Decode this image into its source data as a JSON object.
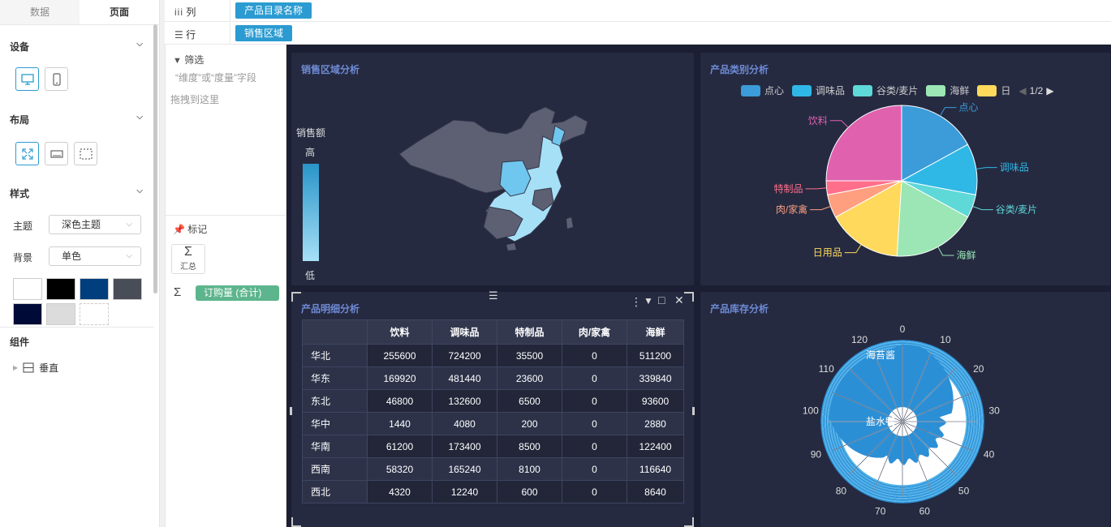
{
  "left_panel": {
    "tabs": [
      {
        "label": "数据",
        "active": false
      },
      {
        "label": "页面",
        "active": true
      }
    ],
    "device": {
      "title": "设备"
    },
    "layout": {
      "title": "布局"
    },
    "style": {
      "title": "样式",
      "theme_label": "主题",
      "theme_value": "深色主题",
      "background_label": "背景",
      "background_value": "单色",
      "swatches": [
        "#ffffff",
        "#000000",
        "#003e7e",
        "#494d58",
        "#000a36",
        "#dcdcdc",
        "#ffffff"
      ]
    },
    "components": {
      "title": "组件",
      "items": [
        {
          "label": "垂直"
        }
      ]
    }
  },
  "shelves": {
    "columns": {
      "label": "列",
      "field": "产品目录名称"
    },
    "rows": {
      "label": "行",
      "field": "销售区域"
    }
  },
  "middle_panel": {
    "filter_title": "筛选",
    "filter_hint_line1": "“维度”或“度量”字段",
    "filter_hint_line2": "拖拽到这里",
    "marks_title": "标记",
    "aggregate_label": "汇总",
    "measure_pill": "订购量 (合计)"
  },
  "cards": {
    "map": {
      "title": "销售区域分析",
      "legend_title": "销售额",
      "legend_high": "高",
      "legend_low": "低"
    },
    "pie": {
      "title": "产品类别分析",
      "legend_items": [
        "点心",
        "调味品",
        "谷类/麦片",
        "海鲜",
        "日"
      ],
      "legend_page": "1/2"
    },
    "table": {
      "title": "产品明细分析",
      "columns": [
        "饮料",
        "调味品",
        "特制品",
        "肉/家禽",
        "海鲜"
      ],
      "rows": [
        {
          "name": "华北",
          "values": [
            "255600",
            "724200",
            "35500",
            "0",
            "511200"
          ]
        },
        {
          "name": "华东",
          "values": [
            "169920",
            "481440",
            "23600",
            "0",
            "339840"
          ]
        },
        {
          "name": "东北",
          "values": [
            "46800",
            "132600",
            "6500",
            "0",
            "93600"
          ]
        },
        {
          "name": "华中",
          "values": [
            "1440",
            "4080",
            "200",
            "0",
            "2880"
          ]
        },
        {
          "name": "华南",
          "values": [
            "61200",
            "173400",
            "8500",
            "0",
            "122400"
          ]
        },
        {
          "name": "西南",
          "values": [
            "58320",
            "165240",
            "8100",
            "0",
            "116640"
          ]
        },
        {
          "name": "西北",
          "values": [
            "4320",
            "12240",
            "600",
            "0",
            "8640"
          ]
        }
      ]
    },
    "polar": {
      "title": "产品库存分析",
      "angle_ticks": [
        "0",
        "10",
        "20",
        "30",
        "40",
        "50",
        "60",
        "70",
        "80",
        "90",
        "100",
        "110",
        "120"
      ],
      "annotations": [
        "海苔酱",
        "盐水鸭"
      ]
    }
  },
  "chart_data": [
    {
      "type": "pie",
      "title": "产品类别分析",
      "categories": [
        "点心",
        "调味品",
        "谷类/麦片",
        "海鲜",
        "日用品",
        "肉/家禽",
        "特制品",
        "饮料"
      ],
      "values": [
        17,
        11,
        5,
        18,
        16,
        5,
        3,
        25
      ],
      "colors": [
        "#3b9cd9",
        "#2fb8e6",
        "#5fd8d8",
        "#9be6b4",
        "#ffd95c",
        "#ff9f7f",
        "#ff6e8a",
        "#e062ae"
      ],
      "legend": "top"
    },
    {
      "type": "table",
      "title": "产品明细分析",
      "categories": [
        "华北",
        "华东",
        "东北",
        "华中",
        "华南",
        "西南",
        "西北"
      ],
      "series": [
        {
          "name": "饮料",
          "values": [
            255600,
            169920,
            46800,
            1440,
            61200,
            58320,
            4320
          ]
        },
        {
          "name": "调味品",
          "values": [
            724200,
            481440,
            132600,
            4080,
            173400,
            165240,
            12240
          ]
        },
        {
          "name": "特制品",
          "values": [
            35500,
            23600,
            6500,
            200,
            8500,
            8100,
            600
          ]
        },
        {
          "name": "肉/家禽",
          "values": [
            0,
            0,
            0,
            0,
            0,
            0,
            0
          ]
        },
        {
          "name": "海鲜",
          "values": [
            511200,
            339840,
            93600,
            2880,
            122400,
            116640,
            8640
          ]
        }
      ]
    }
  ]
}
